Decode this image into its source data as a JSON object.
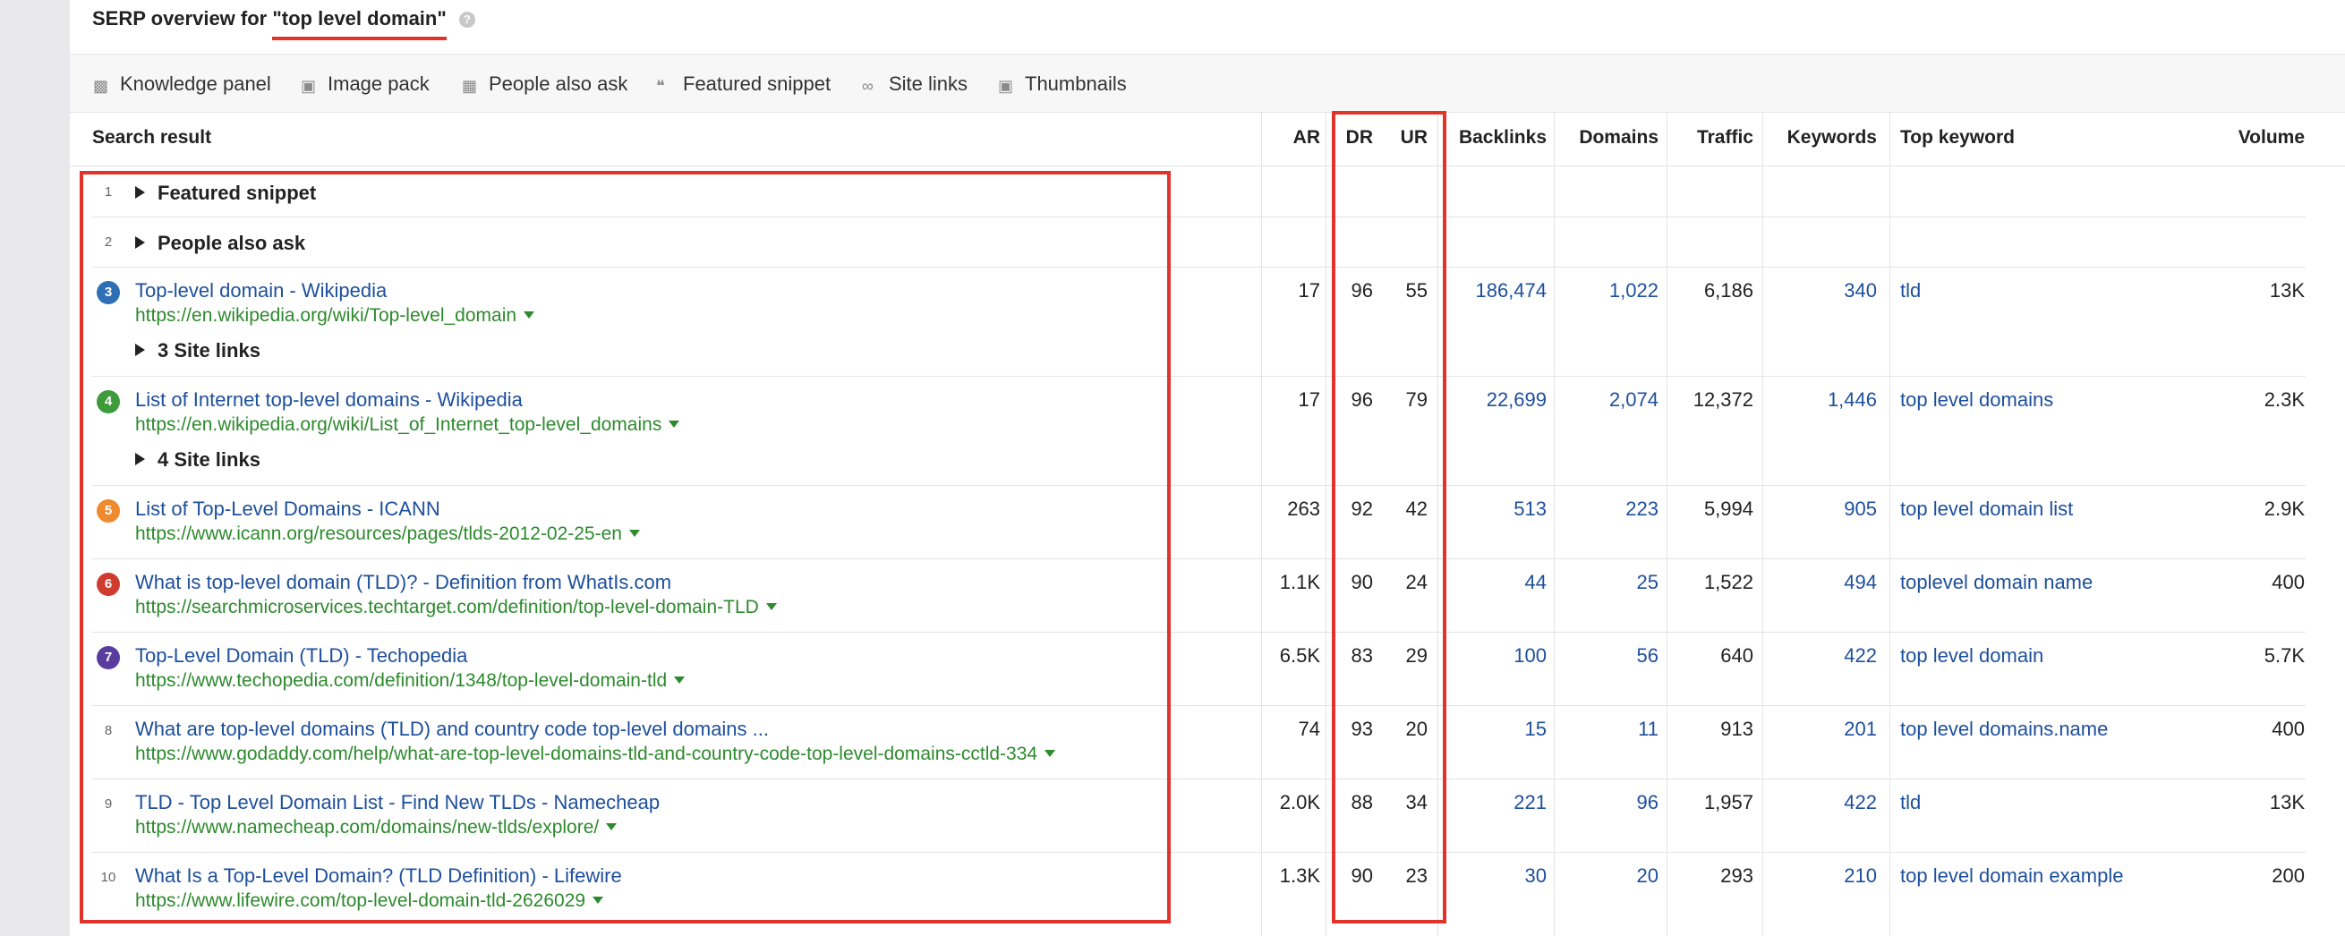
{
  "overview": {
    "title_prefix": "SERP overview for ",
    "query": "\"top level domain\"",
    "help_icon": "?"
  },
  "features": [
    {
      "label": "Knowledge panel",
      "icon": "knowledge-panel-icon"
    },
    {
      "label": "Image pack",
      "icon": "image-pack-icon"
    },
    {
      "label": "People also ask",
      "icon": "people-also-ask-icon"
    },
    {
      "label": "Featured snippet",
      "icon": "featured-snippet-icon"
    },
    {
      "label": "Site links",
      "icon": "site-links-icon"
    },
    {
      "label": "Thumbnails",
      "icon": "thumbnails-icon"
    }
  ],
  "columns": {
    "result": "Search result",
    "ar": "AR",
    "dr": "DR",
    "ur": "UR",
    "backlinks": "Backlinks",
    "domains": "Domains",
    "traffic": "Traffic",
    "keywords": "Keywords",
    "top_keyword": "Top keyword",
    "volume": "Volume"
  },
  "toggles": {
    "featured_snippet": {
      "rank": "1",
      "label": "Featured snippet"
    },
    "people_also_ask": {
      "rank": "2",
      "label": "People also ask"
    }
  },
  "rows": [
    {
      "rank": "3",
      "badge_color": "#2f6fb5",
      "title": "Top-level domain - Wikipedia",
      "url": "https://en.wikipedia.org/wiki/Top-level_domain",
      "ar": "17",
      "dr": "96",
      "ur": "55",
      "backlinks": "186,474",
      "domains": "1,022",
      "traffic": "6,186",
      "keywords": "340",
      "top_keyword": "tld",
      "volume": "13K",
      "sitelinks": "3 Site links"
    },
    {
      "rank": "4",
      "badge_color": "#3e9a3a",
      "title": "List of Internet top-level domains - Wikipedia",
      "url": "https://en.wikipedia.org/wiki/List_of_Internet_top-level_domains",
      "ar": "17",
      "dr": "96",
      "ur": "79",
      "backlinks": "22,699",
      "domains": "2,074",
      "traffic": "12,372",
      "keywords": "1,446",
      "top_keyword": "top level domains",
      "volume": "2.3K",
      "sitelinks": "4 Site links"
    },
    {
      "rank": "5",
      "badge_color": "#ef8a2e",
      "title": "List of Top-Level Domains - ICANN",
      "url": "https://www.icann.org/resources/pages/tlds-2012-02-25-en",
      "ar": "263",
      "dr": "92",
      "ur": "42",
      "backlinks": "513",
      "domains": "223",
      "traffic": "5,994",
      "keywords": "905",
      "top_keyword": "top level domain list",
      "volume": "2.9K"
    },
    {
      "rank": "6",
      "badge_color": "#d03b2f",
      "title": "What is top-level domain (TLD)? - Definition from WhatIs.com",
      "url": "https://searchmicroservices.techtarget.com/definition/top-level-domain-TLD",
      "ar": "1.1K",
      "dr": "90",
      "ur": "24",
      "backlinks": "44",
      "domains": "25",
      "traffic": "1,522",
      "keywords": "494",
      "top_keyword": "toplevel domain name",
      "volume": "400"
    },
    {
      "rank": "7",
      "badge_color": "#5a3c9e",
      "title": "Top-Level Domain (TLD) - Techopedia",
      "url": "https://www.techopedia.com/definition/1348/top-level-domain-tld",
      "ar": "6.5K",
      "dr": "83",
      "ur": "29",
      "backlinks": "100",
      "domains": "56",
      "traffic": "640",
      "keywords": "422",
      "top_keyword": "top level domain",
      "volume": "5.7K"
    },
    {
      "rank": "8",
      "badge_color": "",
      "title": "What are top-level domains (TLD) and country code top-level domains ...",
      "url": "https://www.godaddy.com/help/what-are-top-level-domains-tld-and-country-code-top-level-domains-cctld-334",
      "ar": "74",
      "dr": "93",
      "ur": "20",
      "backlinks": "15",
      "domains": "11",
      "traffic": "913",
      "keywords": "201",
      "top_keyword": "top level domains.name",
      "volume": "400"
    },
    {
      "rank": "9",
      "badge_color": "",
      "title": "TLD - Top Level Domain List - Find New TLDs - Namecheap",
      "url": "https://www.namecheap.com/domains/new-tlds/explore/",
      "ar": "2.0K",
      "dr": "88",
      "ur": "34",
      "backlinks": "221",
      "domains": "96",
      "traffic": "1,957",
      "keywords": "422",
      "top_keyword": "tld",
      "volume": "13K"
    },
    {
      "rank": "10",
      "badge_color": "",
      "title": "What Is a Top-Level Domain? (TLD Definition) - Lifewire",
      "url": "https://www.lifewire.com/top-level-domain-tld-2626029",
      "ar": "1.3K",
      "dr": "90",
      "ur": "23",
      "backlinks": "30",
      "domains": "20",
      "traffic": "293",
      "keywords": "210",
      "top_keyword": "top level domain example",
      "volume": "200"
    }
  ],
  "colors": {
    "link": "#1d4f9c",
    "url": "#2d8a2d",
    "highlight": "#e0342a"
  }
}
